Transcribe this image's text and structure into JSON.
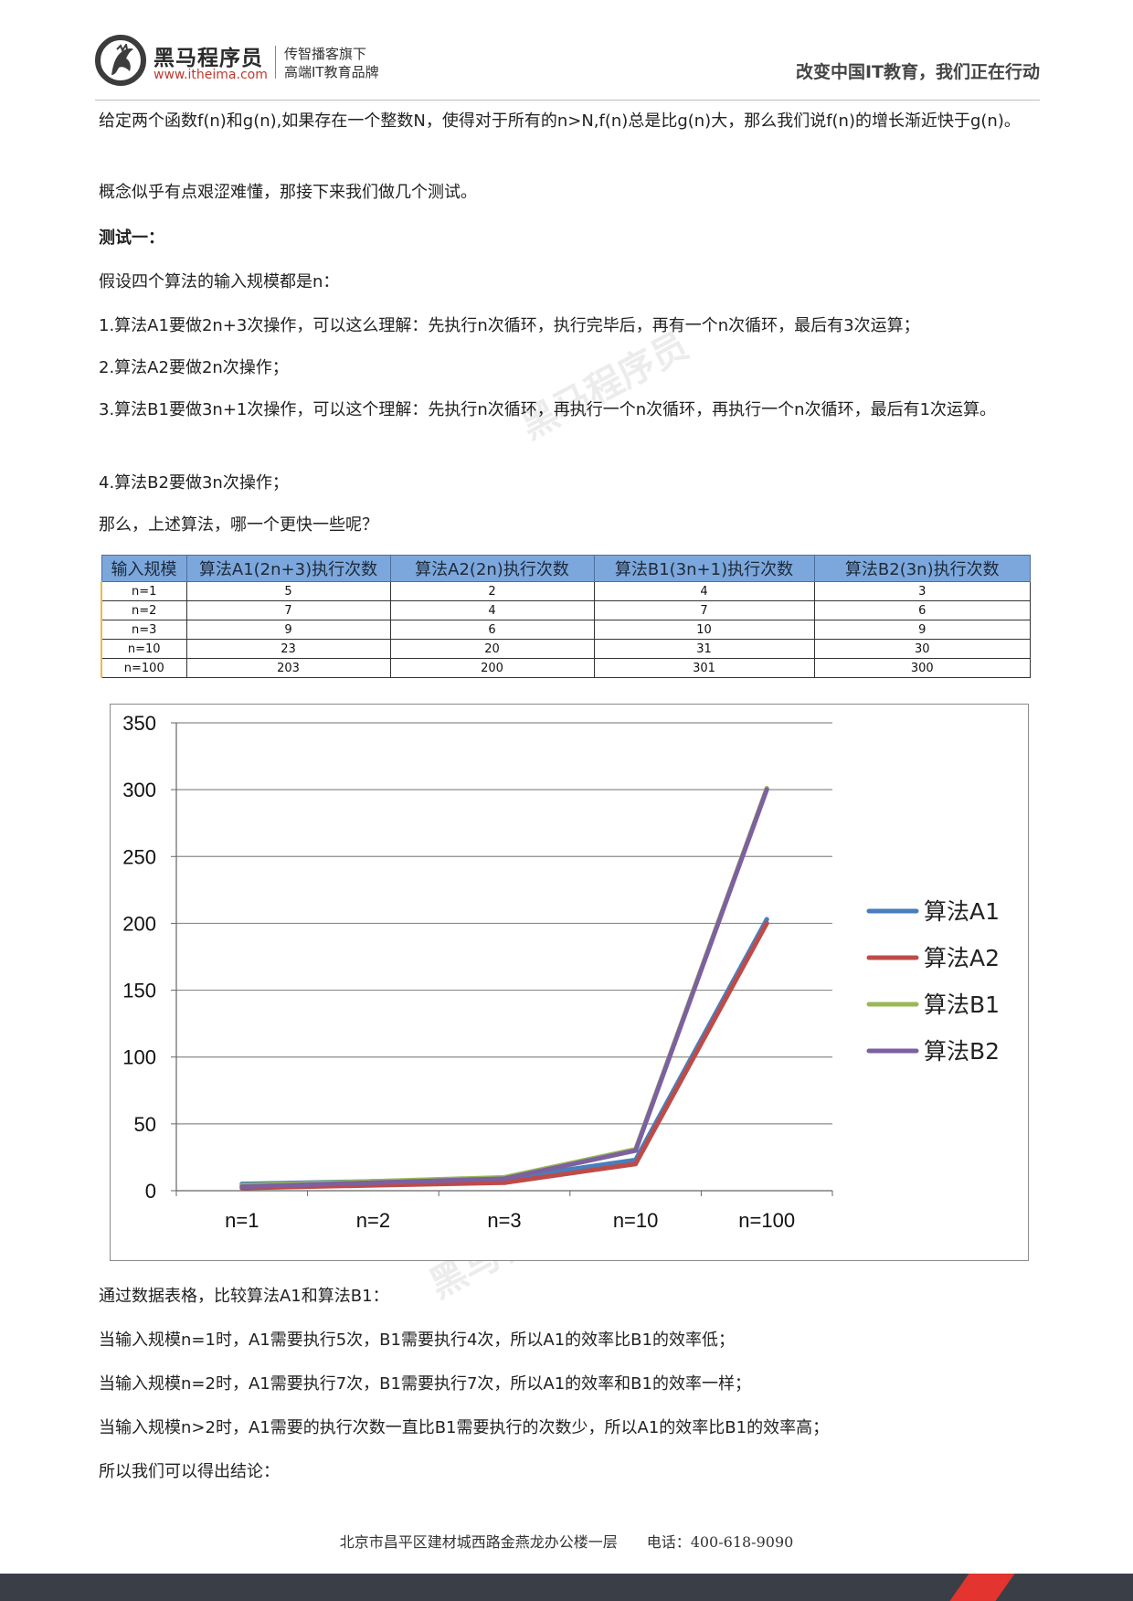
{
  "header": {
    "brand_name": "黑马程序员",
    "brand_url": "www.itheima.com",
    "tagline_1": "传智播客旗下",
    "tagline_2": "高端IT教育品牌",
    "slogan": "改变中国IT教育，我们正在行动",
    "watermark_text": "黑马程序员"
  },
  "paragraphs": {
    "p1": " 给定两个函数f(n)和g(n),如果存在一个整数N，使得对于所有的n>N,f(n)总是比g(n)大，那么我们说f(n)的增长渐近快于g(n)。",
    "p2": "概念似乎有点艰涩难懂，那接下来我们做几个测试。",
    "test1_heading": "测试一：",
    "p3": "假设四个算法的输入规模都是n：",
    "item1": " 1.算法A1要做2n+3次操作，可以这么理解：先执行n次循环，执行完毕后，再有一个n次循环，最后有3次运算；",
    "item2": " 2.算法A2要做2n次操作；",
    "item3": " 3.算法B1要做3n+1次操作，可以这个理解：先执行n次循环，再执行一个n次循环，再执行一个n次循环，最后有1次运算。",
    "item4": " 4.算法B2要做3n次操作；",
    "question": "那么，上述算法，哪一个更快一些呢？",
    "after_chart": "通过数据表格，比较算法A1和算法B1：",
    "c1": " 当输入规模n=1时，A1需要执行5次，B1需要执行4次，所以A1的效率比B1的效率低；",
    "c2": " 当输入规模n=2时，A1需要执行7次，B1需要执行7次，所以A1的效率和B1的效率一样；",
    "c3": " 当输入规模n>2时，A1需要的执行次数一直比B1需要执行的次数少，所以A1的效率比B1的效率高；",
    "c4": " 所以我们可以得出结论："
  },
  "table": {
    "headers": [
      "输入规模",
      "算法A1(2n+3)执行次数",
      "算法A2(2n)执行次数",
      "算法B1(3n+1)执行次数",
      "算法B2(3n)执行次数"
    ],
    "rows": [
      [
        "n=1",
        "5",
        "2",
        "4",
        "3"
      ],
      [
        "n=2",
        "7",
        "4",
        "7",
        "6"
      ],
      [
        "n=3",
        "9",
        "6",
        "10",
        "9"
      ],
      [
        "n=10",
        "23",
        "20",
        "31",
        "30"
      ],
      [
        "n=100",
        "203",
        "200",
        "301",
        "300"
      ]
    ]
  },
  "chart_data": {
    "type": "line",
    "categories": [
      "n=1",
      "n=2",
      "n=3",
      "n=10",
      "n=100"
    ],
    "series": [
      {
        "name": "算法A1",
        "values": [
          5,
          7,
          9,
          23,
          203
        ],
        "color": "#4a7ebb"
      },
      {
        "name": "算法A2",
        "values": [
          2,
          4,
          6,
          20,
          200
        ],
        "color": "#be4b48"
      },
      {
        "name": "算法B1",
        "values": [
          4,
          7,
          10,
          31,
          301
        ],
        "color": "#98b954"
      },
      {
        "name": "算法B2",
        "values": [
          3,
          6,
          9,
          30,
          300
        ],
        "color": "#7d60a0"
      }
    ],
    "yticks": [
      0,
      50,
      100,
      150,
      200,
      250,
      300,
      350
    ],
    "ylim": [
      0,
      350
    ],
    "grid": true,
    "legend": "right"
  },
  "footer": {
    "address": "北京市昌平区建材城西路金燕龙办公楼一层　　电话：400-618-9090"
  }
}
